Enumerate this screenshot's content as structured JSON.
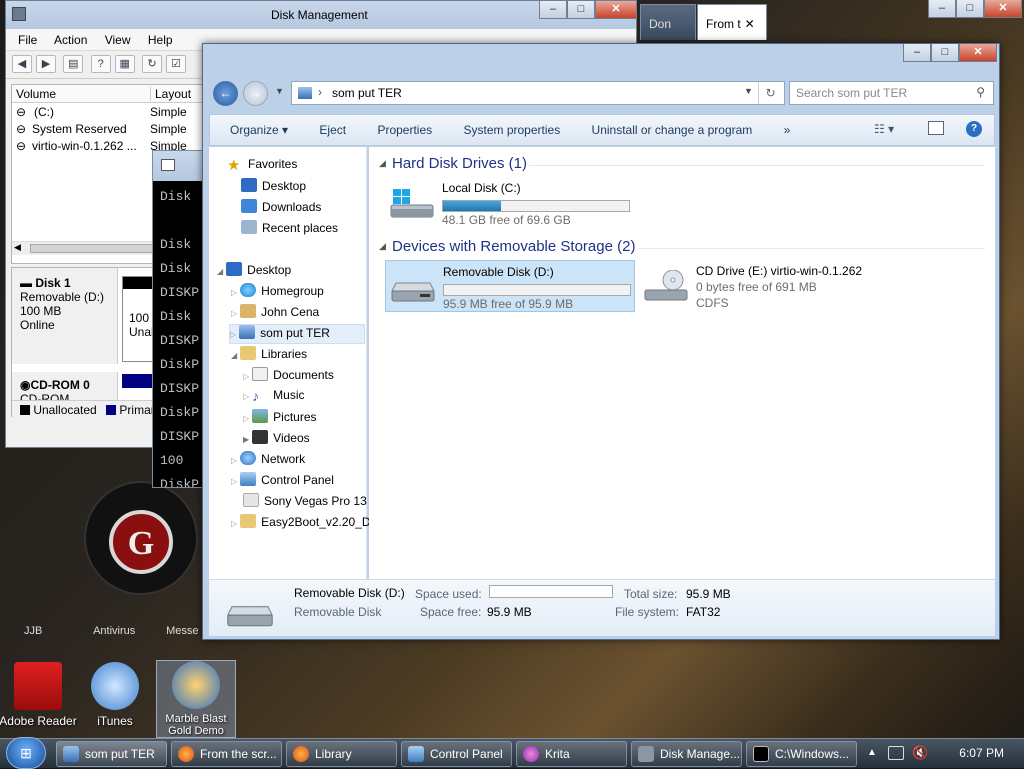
{
  "disk_mgmt": {
    "title": "Disk Management",
    "menu": [
      "File",
      "Action",
      "View",
      "Help"
    ],
    "columns": [
      "Volume",
      "Layout"
    ],
    "volumes": [
      {
        "name": "(C:)",
        "layout": "Simple"
      },
      {
        "name": "System Reserved",
        "layout": "Simple"
      },
      {
        "name": "virtio-win-0.1.262 ...",
        "layout": "Simple"
      }
    ],
    "disk1": {
      "name": "Disk 1",
      "type": "Removable (D:)",
      "size": "100 MB",
      "status": "Online",
      "part_size": "100 M",
      "part_state": "Unall"
    },
    "cdrom": {
      "name": "CD-ROM 0",
      "type": "CD-ROM"
    },
    "legend": [
      "Unallocated",
      "Primar"
    ]
  },
  "console": {
    "lines": [
      "Disk",
      "",
      "Disk",
      "Disk",
      "DISKP",
      "Disk",
      "DISKP",
      "DiskP",
      "DISKP",
      "DiskP",
      "DISKP",
      "100",
      "DiskP",
      "DISKP"
    ]
  },
  "tabs": [
    {
      "label": "Don"
    },
    {
      "label": "From t"
    }
  ],
  "explorer": {
    "address": "som put TER",
    "search_placeholder": "Search som put TER",
    "commands": [
      "Organize",
      "Eject",
      "Properties",
      "System properties",
      "Uninstall or change a program",
      "»"
    ],
    "nav": {
      "favorites": "Favorites",
      "desktop_fav": "Desktop",
      "downloads": "Downloads",
      "recent": "Recent places",
      "desktop": "Desktop",
      "homegroup": "Homegroup",
      "john": "John Cena",
      "computer": "som put TER",
      "libraries": "Libraries",
      "documents": "Documents",
      "music": "Music",
      "pictures": "Pictures",
      "videos": "Videos",
      "network": "Network",
      "control_panel": "Control Panel",
      "sony": "Sony Vegas Pro 13",
      "easy2boot": "Easy2Boot_v2.20_DP"
    },
    "groups": {
      "hdd": "Hard Disk Drives (1)",
      "removable": "Devices with Removable Storage (2)"
    },
    "drives": {
      "c": {
        "name": "Local Disk (C:)",
        "free": "48.1 GB free of 69.6 GB",
        "used_fraction": 0.31
      },
      "d": {
        "name": "Removable Disk (D:)",
        "free": "95.9 MB free of 95.9 MB",
        "used_fraction": 0.0
      },
      "e": {
        "name": "CD Drive (E:) virtio-win-0.1.262",
        "free": "0 bytes free of 691 MB",
        "fs": "CDFS"
      }
    },
    "details": {
      "name": "Removable Disk (D:)",
      "kind": "Removable Disk",
      "space_used_label": "Space used:",
      "space_free_label": "Space free:",
      "space_free": "95.9 MB",
      "total_label": "Total size:",
      "total": "95.9 MB",
      "fs_label": "File system:",
      "fs": "FAT32"
    }
  },
  "desktop_icons": [
    {
      "label": "Adobe Reader"
    },
    {
      "label": "iTunes"
    },
    {
      "label": "Marble Blast Gold Demo"
    }
  ],
  "desktop_partial_labels": [
    "JJB",
    "Antivirus",
    "Messe"
  ],
  "taskbar": {
    "buttons": [
      {
        "label": "som put TER"
      },
      {
        "label": "From the scr..."
      },
      {
        "label": "Library"
      },
      {
        "label": "Control Panel"
      },
      {
        "label": "Krita"
      },
      {
        "label": "Disk Manage..."
      },
      {
        "label": "C:\\Windows..."
      }
    ],
    "clock": "6:07 PM"
  }
}
